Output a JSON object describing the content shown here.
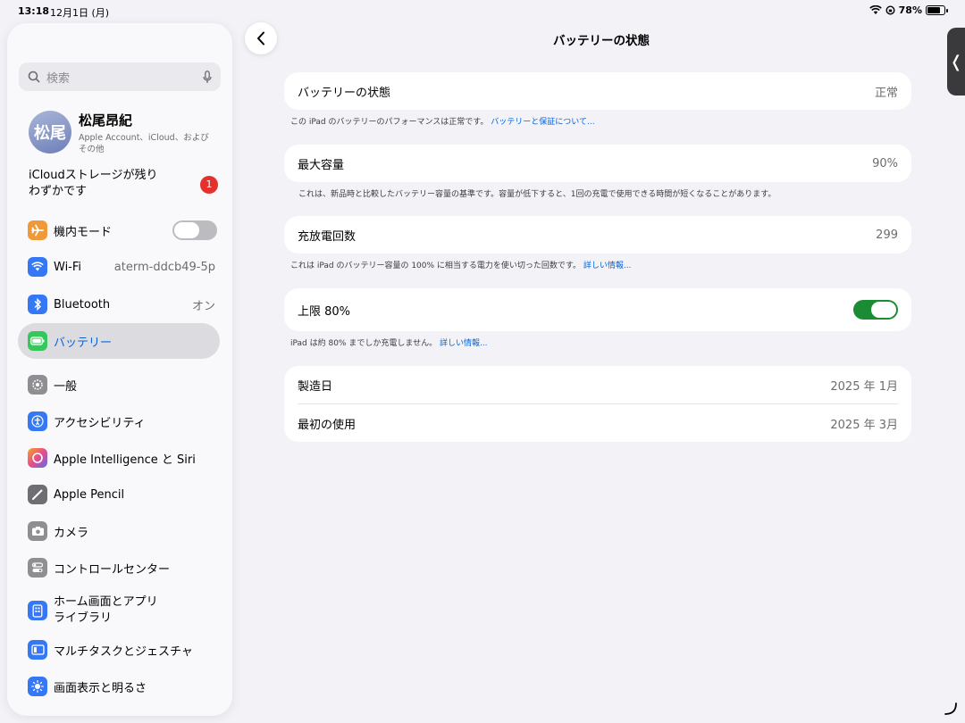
{
  "status_bar": {
    "time": "13:18",
    "date": "12月1日 (月)",
    "battery": "78%"
  },
  "sidebar": {
    "search_placeholder": "検索",
    "profile": {
      "avatar_text": "松尾",
      "name": "松尾昂紀",
      "subtitle": "Apple Account、iCloud、およびその他"
    },
    "icloud": {
      "line1": "iCloudストレージが残り",
      "line2": "わずかです",
      "badge": "1"
    },
    "items": [
      {
        "label": "機内モード",
        "icon": "airplane-icon",
        "color": "#f09a37"
      },
      {
        "label": "Wi-Fi",
        "value": "aterm-ddcb49-5p",
        "icon": "wifi-icon",
        "color": "#3478f6"
      },
      {
        "label": "Bluetooth",
        "value": "オン",
        "icon": "bluetooth-icon",
        "color": "#3478f6"
      },
      {
        "label": "バッテリー",
        "icon": "battery-icon",
        "color": "#34c759"
      },
      {
        "label": "一般",
        "icon": "gear-icon",
        "color": "#8e8e93"
      },
      {
        "label": "アクセシビリティ",
        "icon": "accessibility-icon",
        "color": "#3478f6"
      },
      {
        "label": "Apple Intelligence と Siri",
        "icon": "siri-icon",
        "color": "#d65cc9"
      },
      {
        "label": "Apple Pencil",
        "icon": "pencil-icon",
        "color": "#6e6e73"
      },
      {
        "label": "カメラ",
        "icon": "camera-icon",
        "color": "#8e8e93"
      },
      {
        "label": "コントロールセンター",
        "icon": "switches-icon",
        "color": "#8e8e93"
      },
      {
        "label_line1": "ホーム画面とアプリ",
        "label_line2": "ライブラリ",
        "icon": "home-screen-icon",
        "color": "#3478f6"
      },
      {
        "label": "マルチタスクとジェスチャ",
        "icon": "multitask-icon",
        "color": "#3478f6"
      },
      {
        "label": "画面表示と明るさ",
        "icon": "brightness-icon",
        "color": "#3478f6"
      }
    ]
  },
  "main": {
    "title": "バッテリーの状態",
    "health": {
      "label": "バッテリーの状態",
      "value": "正常"
    },
    "health_note": "この iPad のバッテリーのパフォーマンスは正常です。",
    "health_link": "バッテリーと保証について...",
    "capacity": {
      "label": "最大容量",
      "value": "90%"
    },
    "capacity_note": "これは、新品時と比較したバッテリー容量の基準です。容量が低下すると、1回の充電で使用できる時間が短くなることがあります。",
    "cycles": {
      "label": "充放電回数",
      "value": "299"
    },
    "cycles_note": "これは iPad のバッテリー容量の 100% に相当する電力を使い切った回数です。",
    "cycles_link": "詳しい情報...",
    "limit": {
      "label": "上限 80%",
      "enabled": true
    },
    "limit_note": "iPad は約 80% までしか充電しません。",
    "limit_link": "詳しい情報...",
    "manufacture": {
      "label": "製造日",
      "value": "2025 年 1月"
    },
    "first_use": {
      "label": "最初の使用",
      "value": "2025 年 3月"
    }
  },
  "colors": {
    "accent": "#0a63d6",
    "toggle_on": "#1b8c34",
    "badge": "#e5312e"
  }
}
